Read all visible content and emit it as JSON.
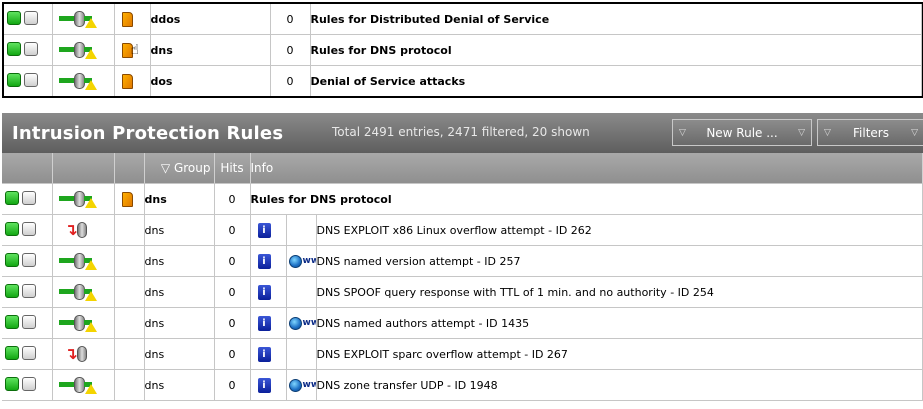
{
  "top_rows": [
    {
      "group": "ddos",
      "hits": "0",
      "info": "Rules for Distributed Denial of Service"
    },
    {
      "group": "dns",
      "hits": "0",
      "info": "Rules for DNS protocol"
    },
    {
      "group": "dos",
      "hits": "0",
      "info": "Denial of Service attacks"
    }
  ],
  "panel": {
    "title": "Intrusion Protection Rules",
    "summary": "Total 2491 entries, 2471 filtered, 20 shown",
    "new_rule_label": "New Rule ...",
    "filters_label": "Filters",
    "dropdown_glyph": "▽"
  },
  "columns": {
    "group": "Group",
    "hits": "Hits",
    "info": "Info",
    "sort_glyph": "▽"
  },
  "group_row": {
    "group": "dns",
    "hits": "0",
    "info": "Rules for DNS protocol"
  },
  "rules": [
    {
      "action": "drop",
      "group": "dns",
      "hits": "0",
      "www": false,
      "desc": "DNS EXPLOIT x86 Linux overflow attempt - ID 262"
    },
    {
      "action": "pass",
      "group": "dns",
      "hits": "0",
      "www": true,
      "desc": "DNS named version attempt - ID 257"
    },
    {
      "action": "pass",
      "group": "dns",
      "hits": "0",
      "www": false,
      "desc": "DNS SPOOF query response with TTL of 1 min. and no authority - ID 254"
    },
    {
      "action": "pass",
      "group": "dns",
      "hits": "0",
      "www": true,
      "desc": "DNS named authors attempt - ID 1435"
    },
    {
      "action": "drop",
      "group": "dns",
      "hits": "0",
      "www": false,
      "desc": "DNS EXPLOIT sparc overflow attempt - ID 267"
    },
    {
      "action": "pass",
      "group": "dns",
      "hits": "0",
      "www": true,
      "desc": "DNS zone transfer UDP - ID 1948"
    }
  ],
  "icons": {
    "enable": "enable-toggle-icon",
    "disable": "disable-toggle-icon",
    "pass": "pass-action-icon",
    "drop": "drop-action-icon",
    "folder": "folder-icon",
    "info": "info-icon",
    "www": "www-link-icon",
    "cursor": "hand-cursor-icon"
  },
  "www_text": "ww",
  "info_glyph": "i",
  "colors": {
    "titlebar": "#6e6e6e",
    "enabled": "#13a813",
    "drop_arrow": "#e02020",
    "info": "#0a1f9a"
  }
}
